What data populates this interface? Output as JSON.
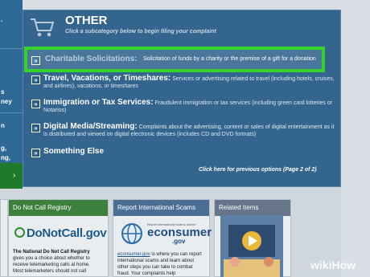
{
  "left_menu": {
    "fragments": [
      ".",
      "s",
      "ney",
      "n",
      "g,",
      "ng,"
    ]
  },
  "category": {
    "title": "OTHER",
    "subtitle": "Click a subcategory below to begin filing your complaint"
  },
  "highlighted_item": {
    "title": "Charitable Solicitations:",
    "description": "Solicitation of funds by a charity or the premise of a gift for a donation"
  },
  "items": [
    {
      "title": "Travel, Vacations, or Timeshares:",
      "description": "Services or advertising related to travel (including hotels, cruises, and airlines), vacations, or timeshares"
    },
    {
      "title": "Immigration or Tax Services:",
      "description": "Fraudulent immigration or tax services (including green card lotteries or Notarios)"
    },
    {
      "title": "Digital Media/Streaming:",
      "description": "Complaints about the advertising, content or sales of digital entertainment as it is distributed and viewed on digital electronic devices (includes CD and DVD formats)"
    },
    {
      "title": "Something Else",
      "description": ""
    }
  ],
  "previous_link": "Click here for previous options (Page 2 of 2)",
  "cards": {
    "do_not_call": {
      "header": "Do Not Call Registry",
      "logo_text": "DoNotCall.gov",
      "body_bold": "The National Do Not Call Registry",
      "body": "gives you a choice about whether to receive telemarketing calls at home. Most telemarketers should not call"
    },
    "international": {
      "header": "Report International Scams",
      "logo_top": "Report international scams online!",
      "logo_text": "econsumer",
      "logo_suffix": ".gov",
      "body_link": "econsumer.gov",
      "body": "is where you can report international scams and learn about other steps you can take to combat fraud. Your complaints help"
    },
    "related": {
      "header": "Related Items"
    }
  },
  "watermark": "wikiHow",
  "colors": {
    "panel_blue": "#33658e",
    "highlight_green": "#35d329",
    "card_green": "#3d7f3c"
  }
}
